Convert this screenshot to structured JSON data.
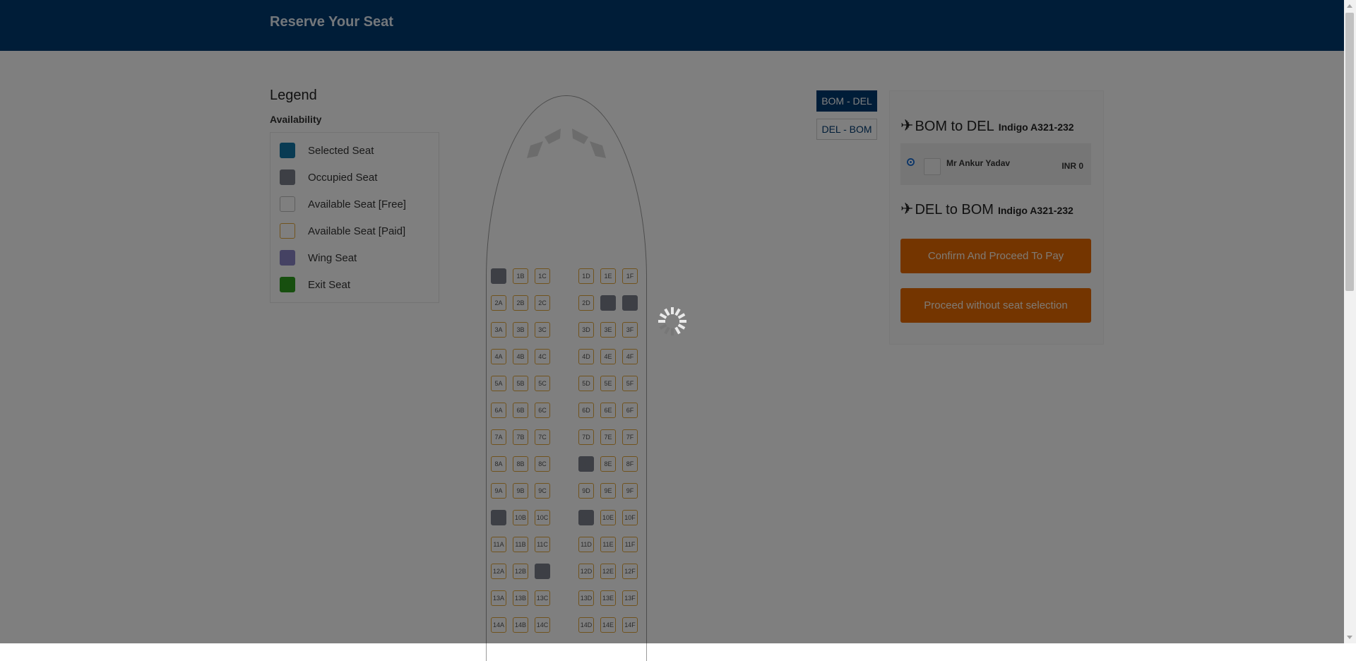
{
  "header": {
    "title": "Reserve Your Seat"
  },
  "legend": {
    "title": "Legend",
    "subtitle": "Availability",
    "items": [
      {
        "label": "Selected Seat",
        "fill": "#1376a6",
        "border": "#1376a6"
      },
      {
        "label": "Occupied Seat",
        "fill": "#7b7f8a",
        "border": "#7b7f8a"
      },
      {
        "label": "Available Seat [Free]",
        "fill": "#ffffff",
        "border": "#bdbdbd"
      },
      {
        "label": "Available Seat [Paid]",
        "fill": "#ffffff",
        "border": "#e3a63b"
      },
      {
        "label": "Wing Seat",
        "fill": "#8a84c6",
        "border": "#8a84c6"
      },
      {
        "label": "Exit Seat",
        "fill": "#2f9e1f",
        "border": "#2f9e1f"
      }
    ]
  },
  "seatmap": {
    "rows": 14,
    "letters_left": [
      "A",
      "B",
      "C"
    ],
    "letters_right": [
      "D",
      "E",
      "F"
    ],
    "occupied": [
      "1A",
      "2E",
      "2F",
      "8D",
      "10A",
      "10D",
      "12C"
    ]
  },
  "tabs": [
    {
      "label": "BOM - DEL",
      "active": true
    },
    {
      "label": "DEL - BOM",
      "active": false
    }
  ],
  "panel": {
    "outbound": {
      "route": "BOM to DEL",
      "aircraft": "Indigo A321-232"
    },
    "passenger": {
      "name": "Mr Ankur Yadav",
      "price": "INR 0"
    },
    "return": {
      "route": "DEL to BOM",
      "aircraft": "Indigo A321-232"
    },
    "confirm_label": "Confirm And Proceed To Pay",
    "skip_label": "Proceed without seat selection"
  },
  "icons": {
    "flight": "airplane-icon",
    "loading": "spinner-icon",
    "avatar": "passenger-avatar-icon"
  }
}
